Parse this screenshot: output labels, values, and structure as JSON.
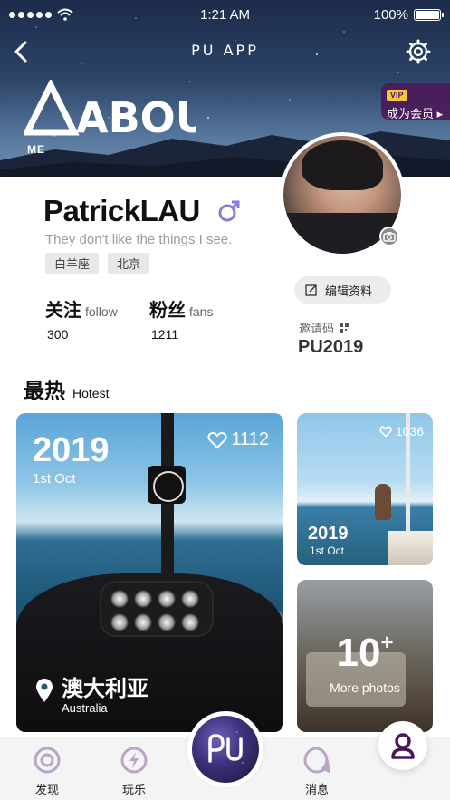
{
  "status_bar": {
    "time": "1:21 AM",
    "battery": "100%"
  },
  "header": {
    "app_title": "PU APP",
    "about_logo_text": "ABOUT",
    "about_sub": "ME",
    "vip_tag": "VIP",
    "vip_label": "成为会员"
  },
  "profile": {
    "name": "PatrickLAU",
    "tagline": "They don't like the things I see.",
    "tags": [
      "白羊座",
      "北京"
    ],
    "follow": {
      "cn": "关注",
      "en": "follow",
      "count": "300"
    },
    "fans": {
      "cn": "粉丝",
      "en": "fans",
      "count": "1211"
    },
    "edit_label": "编辑资料",
    "invite_label": "邀请码",
    "invite_code": "PU2019"
  },
  "hottest": {
    "title_cn": "最热",
    "title_en": "Hotest",
    "cards": [
      {
        "year": "2019",
        "date": "1st Oct",
        "likes": "1112",
        "location_cn": "澳大利亚",
        "location_en": "Australia"
      },
      {
        "year": "2019",
        "date": "1st Oct",
        "likes": "1036"
      },
      {
        "count": "10",
        "count_suffix": "+",
        "label": "More photos"
      }
    ]
  },
  "tabbar": {
    "discover": "发现",
    "play": "玩乐",
    "messages": "消息",
    "center_logo": "PU"
  },
  "colors": {
    "accent_purple": "#4a1858",
    "gender_purple": "#8a7bd6",
    "vip_gold": "#f5c542"
  }
}
